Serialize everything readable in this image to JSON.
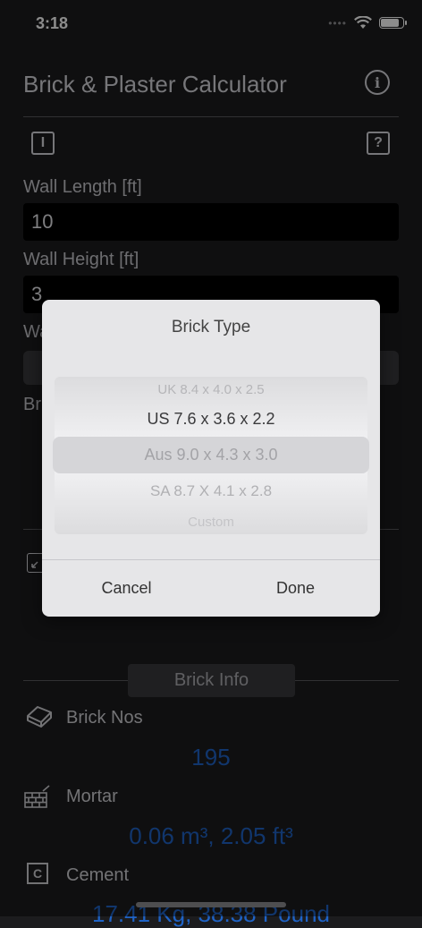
{
  "status": {
    "time": "3:18"
  },
  "header": {
    "title": "Brick & Plaster Calculator",
    "info_icon": "info-circle-icon"
  },
  "toolbar": {
    "left_icon_text": "I",
    "right_icon_text": "?"
  },
  "form": {
    "wall_length_label": "Wall Length [ft]",
    "wall_length_value": "10",
    "wall_height_label": "Wall Height [ft]",
    "wall_height_value": "3",
    "partial_label_1": "Wa",
    "partial_label_2": "Br"
  },
  "brick_info": {
    "section_label": "Brick Info",
    "brick_nos_label": "Brick Nos",
    "brick_nos_value": "195",
    "mortar_label": "Mortar",
    "mortar_value": "0.06 m³, 2.05 ft³",
    "cement_label": "Cement",
    "cement_value": "17.41 Kg, 38.38 Pound"
  },
  "dialog": {
    "title": "Brick Type",
    "options": [
      "UK 8.4 x 4.0 x 2.5",
      "US 7.6 x 3.6 x 2.2",
      "Aus 9.0 x 4.3 x 3.0",
      "SA 8.7 X 4.1 x 2.8",
      "Custom"
    ],
    "selected_index": 2,
    "cancel_label": "Cancel",
    "done_label": "Done"
  }
}
